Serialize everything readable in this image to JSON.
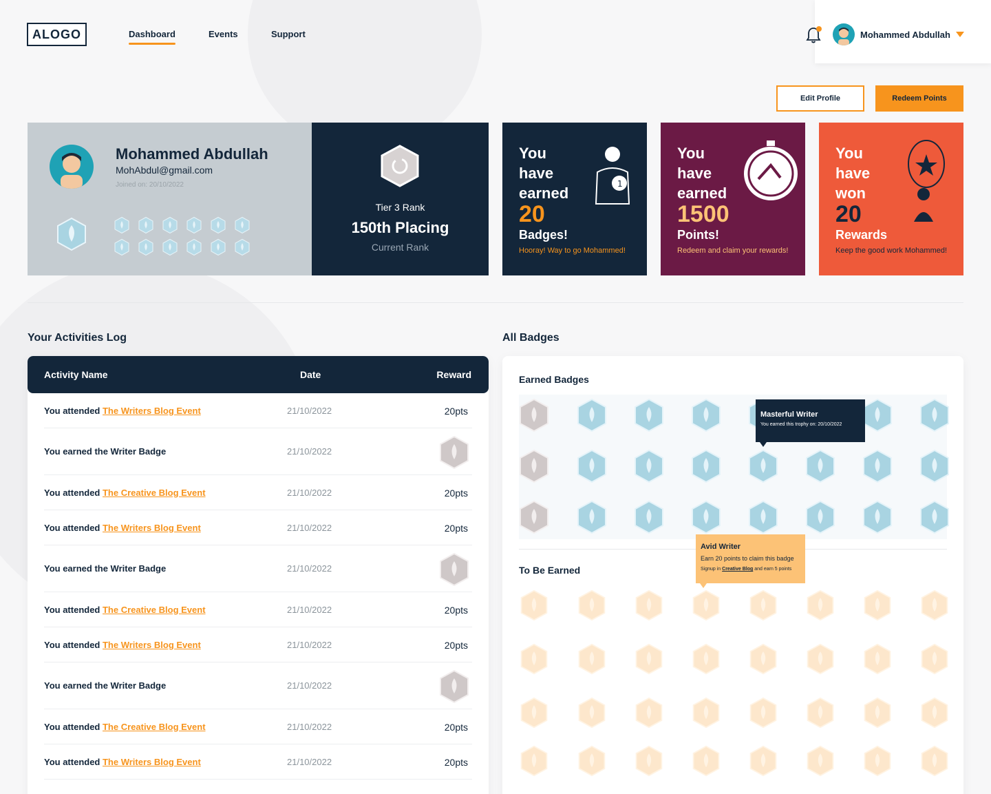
{
  "brand": {
    "logo": "ALOGO",
    "accent": "#f7941d",
    "navy": "#13263a"
  },
  "nav": {
    "items": [
      "Dashboard",
      "Events",
      "Support"
    ],
    "active": "Dashboard"
  },
  "user": {
    "name": "Mohammed Abdullah",
    "notification_icon": "bell-icon"
  },
  "actions": {
    "edit_profile": "Edit Profile",
    "redeem_points": "Redeem Points"
  },
  "profile": {
    "name": "Mohammed Abdullah",
    "email": "MohAbdul@gmail.com",
    "joined": "Joined on: 20/10/2022"
  },
  "rank": {
    "tier": "Tier 3 Rank",
    "placing": "150th Placing",
    "label": "Current Rank"
  },
  "stats": [
    {
      "l1": "You",
      "l2": "have",
      "l3": "earned",
      "number": "20",
      "label": "Badges!",
      "sub": "Hooray! Way to go Mohammed!",
      "bg": "#13263a",
      "number_color": "#f7941d"
    },
    {
      "l1": "You",
      "l2": "have",
      "l3": "earned",
      "number": "1500",
      "label": "Points!",
      "sub": "Redeem and claim your rewards!",
      "bg": "#6b1a45",
      "number_color": "#fcc276"
    },
    {
      "l1": "You",
      "l2": "have",
      "l3": "won",
      "number": "20",
      "label": "Rewards",
      "sub": "Keep the good work Mohammed!",
      "bg": "#ee5a3a",
      "number_color": "#13263a"
    }
  ],
  "activities": {
    "title": "Your Activities Log",
    "columns": [
      "Activity Name",
      "Date",
      "Reward"
    ],
    "rows": [
      {
        "prefix": "You attended ",
        "link": "The Writers Blog Event",
        "date": "21/10/2022",
        "reward": "20pts"
      },
      {
        "prefix": "You earned the Writer Badge",
        "link": "",
        "date": "21/10/2022",
        "reward": ""
      },
      {
        "prefix": "You attended ",
        "link": "The Creative Blog Event",
        "date": "21/10/2022",
        "reward": "20pts"
      },
      {
        "prefix": "You attended ",
        "link": "The Writers Blog Event",
        "date": "21/10/2022",
        "reward": "20pts"
      },
      {
        "prefix": "You earned the Writer Badge",
        "link": "",
        "date": "21/10/2022",
        "reward": ""
      },
      {
        "prefix": "You attended ",
        "link": "The Creative Blog Event",
        "date": "21/10/2022",
        "reward": "20pts"
      },
      {
        "prefix": "You attended ",
        "link": "The Writers Blog Event",
        "date": "21/10/2022",
        "reward": "20pts"
      },
      {
        "prefix": "You earned the Writer Badge",
        "link": "",
        "date": "21/10/2022",
        "reward": ""
      },
      {
        "prefix": "You attended ",
        "link": "The Creative Blog Event",
        "date": "21/10/2022",
        "reward": "20pts"
      },
      {
        "prefix": "You attended ",
        "link": "The Writers Blog Event",
        "date": "21/10/2022",
        "reward": "20pts"
      }
    ]
  },
  "badges": {
    "title": "All Badges",
    "earned_title": "Earned Badges",
    "to_earn_title": "To Be Earned",
    "tooltip_earned": {
      "title": "Masterful Writer",
      "text": "You earned this trophy on: 20/10/2022"
    },
    "tooltip_to_earn": {
      "title": "Avid Writer",
      "text": "Earn 20 points to claim this badge",
      "hint_prefix": "Signup in ",
      "hint_link": "Creative Blog",
      "hint_suffix": " and earn 5 points"
    }
  }
}
